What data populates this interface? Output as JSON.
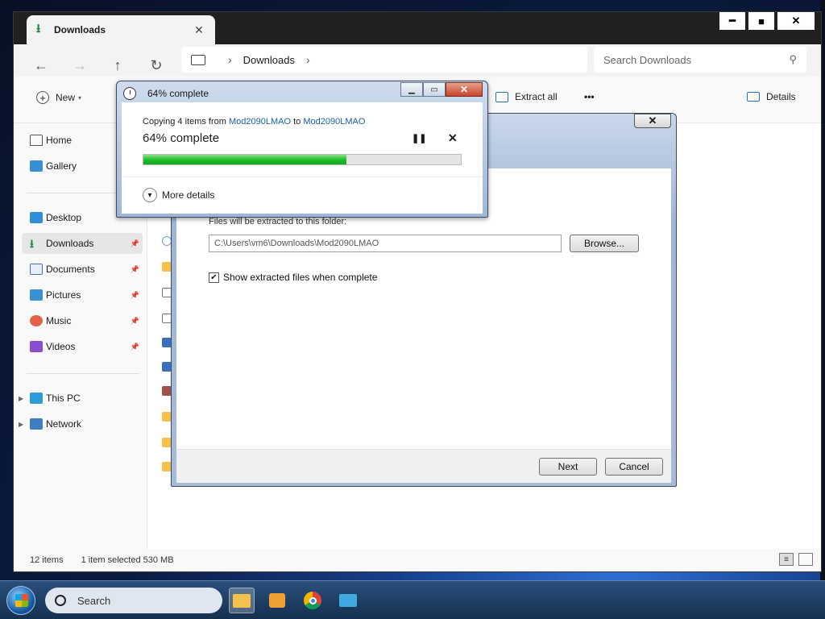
{
  "explorer": {
    "tab_label": "Downloads",
    "address": {
      "segment": "Downloads"
    },
    "search_placeholder": "Search Downloads",
    "toolbar": {
      "new_label": "New",
      "extract_all_label": "Extract all",
      "more_label": "•••",
      "details_label": "Details"
    },
    "sidebar": {
      "items": [
        {
          "label": "Home",
          "icon": "home-icon"
        },
        {
          "label": "Gallery",
          "icon": "gallery-icon"
        },
        {
          "label": "Desktop",
          "icon": "desktop-icon"
        },
        {
          "label": "Downloads",
          "icon": "download-icon"
        },
        {
          "label": "Documents",
          "icon": "documents-icon"
        },
        {
          "label": "Pictures",
          "icon": "pictures-icon"
        },
        {
          "label": "Music",
          "icon": "music-icon"
        },
        {
          "label": "Videos",
          "icon": "videos-icon"
        },
        {
          "label": "This PC",
          "icon": "this-pc-icon"
        },
        {
          "label": "Network",
          "icon": "network-icon"
        }
      ]
    },
    "status": {
      "items": "12 items",
      "selection": "1 item selected  530 MB"
    }
  },
  "wizard": {
    "folder_label": "Files will be extracted to this folder:",
    "path": "C:\\Users\\vm6\\Downloads\\Mod2090LMAO",
    "browse_label": "Browse...",
    "show_checkbox_label": "Show extracted files when complete",
    "show_checked": true,
    "next_label": "Next",
    "cancel_label": "Cancel"
  },
  "progress": {
    "title": "64% complete",
    "copying_prefix": "Copying 4 items from ",
    "source": "Mod2090LMAO",
    "to_word": " to ",
    "dest": "Mod2090LMAO",
    "percent_text": "64% complete",
    "percent": 64,
    "more_details": "More details"
  },
  "taskbar": {
    "search_label": "Search"
  },
  "colors": {
    "accent": "#1a5fa8",
    "progress": "#1fbf2a",
    "download_green": "#1f8a4c"
  }
}
